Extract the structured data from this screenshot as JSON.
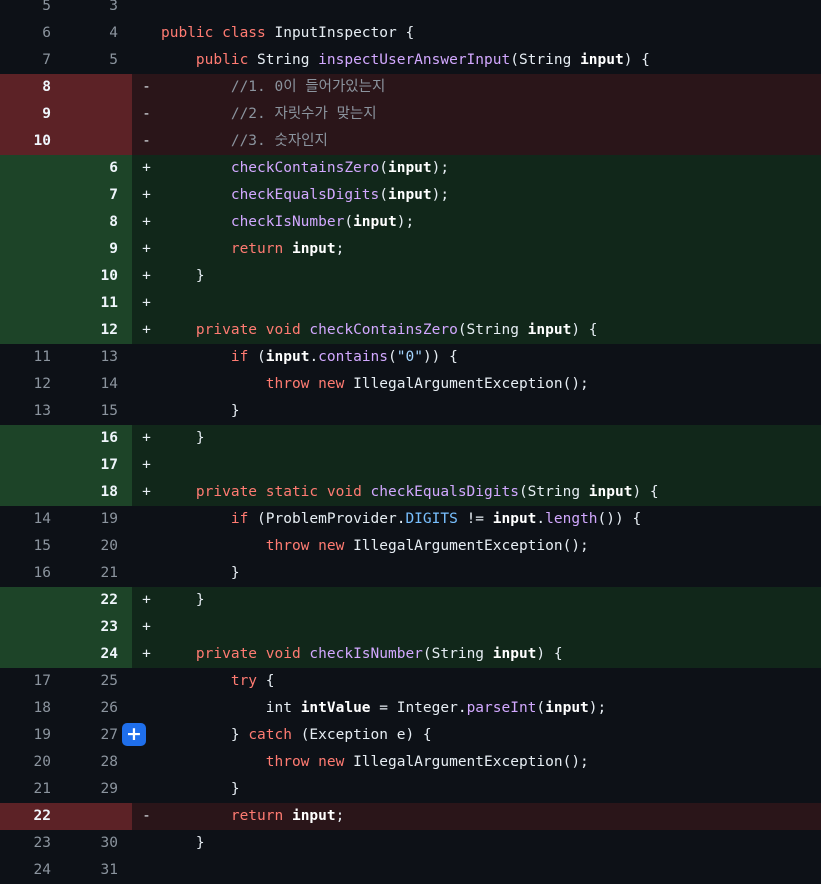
{
  "colors": {
    "background": "#0d1117",
    "deleted_row": "#2a1519",
    "deleted_gutter": "#5c2226",
    "added_row": "#11271a",
    "added_gutter": "#1d4428",
    "keyword": "#ff7b72",
    "function": "#d2a8ff",
    "string": "#a5d6ff",
    "constant": "#79c0ff",
    "comment": "#8b949e",
    "expand_button": "#1f6feb"
  },
  "expand_button": {
    "icon": "plus-icon",
    "glyph": "+"
  },
  "lines": [
    {
      "type": "ctx",
      "old": "5",
      "new": "3",
      "sign": "",
      "tokens": []
    },
    {
      "type": "ctx",
      "old": "6",
      "new": "4",
      "sign": "",
      "tokens": [
        {
          "t": "kw",
          "v": "public class"
        },
        {
          "t": "",
          "v": " InputInspector {"
        }
      ]
    },
    {
      "type": "ctx",
      "old": "7",
      "new": "5",
      "sign": "",
      "tokens": [
        {
          "t": "",
          "v": "    "
        },
        {
          "t": "kw",
          "v": "public"
        },
        {
          "t": "",
          "v": " String "
        },
        {
          "t": "fn",
          "v": "inspectUserAnswerInput"
        },
        {
          "t": "",
          "v": "(String "
        },
        {
          "t": "var",
          "v": "input"
        },
        {
          "t": "",
          "v": ") {"
        }
      ]
    },
    {
      "type": "del",
      "old": "8",
      "new": "",
      "sign": "-",
      "tokens": [
        {
          "t": "",
          "v": "        "
        },
        {
          "t": "cm",
          "v": "//1. 0이 들어가있는지"
        }
      ]
    },
    {
      "type": "del",
      "old": "9",
      "new": "",
      "sign": "-",
      "tokens": [
        {
          "t": "",
          "v": "        "
        },
        {
          "t": "cm",
          "v": "//2. 자릿수가 맞는지"
        }
      ]
    },
    {
      "type": "del",
      "old": "10",
      "new": "",
      "sign": "-",
      "tokens": [
        {
          "t": "",
          "v": "        "
        },
        {
          "t": "cm",
          "v": "//3. 숫자인지"
        }
      ]
    },
    {
      "type": "add",
      "old": "",
      "new": "6",
      "sign": "+",
      "tokens": [
        {
          "t": "",
          "v": "        "
        },
        {
          "t": "fn",
          "v": "checkContainsZero"
        },
        {
          "t": "",
          "v": "("
        },
        {
          "t": "var",
          "v": "input"
        },
        {
          "t": "",
          "v": ");"
        }
      ]
    },
    {
      "type": "add",
      "old": "",
      "new": "7",
      "sign": "+",
      "tokens": [
        {
          "t": "",
          "v": "        "
        },
        {
          "t": "fn",
          "v": "checkEqualsDigits"
        },
        {
          "t": "",
          "v": "("
        },
        {
          "t": "var",
          "v": "input"
        },
        {
          "t": "",
          "v": ");"
        }
      ]
    },
    {
      "type": "add",
      "old": "",
      "new": "8",
      "sign": "+",
      "tokens": [
        {
          "t": "",
          "v": "        "
        },
        {
          "t": "fn",
          "v": "checkIsNumber"
        },
        {
          "t": "",
          "v": "("
        },
        {
          "t": "var",
          "v": "input"
        },
        {
          "t": "",
          "v": ");"
        }
      ]
    },
    {
      "type": "add",
      "old": "",
      "new": "9",
      "sign": "+",
      "tokens": [
        {
          "t": "",
          "v": "        "
        },
        {
          "t": "kw",
          "v": "return"
        },
        {
          "t": "",
          "v": " "
        },
        {
          "t": "var",
          "v": "input"
        },
        {
          "t": "",
          "v": ";"
        }
      ]
    },
    {
      "type": "add",
      "old": "",
      "new": "10",
      "sign": "+",
      "tokens": [
        {
          "t": "",
          "v": "    }"
        }
      ]
    },
    {
      "type": "add",
      "old": "",
      "new": "11",
      "sign": "+",
      "tokens": []
    },
    {
      "type": "add",
      "old": "",
      "new": "12",
      "sign": "+",
      "tokens": [
        {
          "t": "",
          "v": "    "
        },
        {
          "t": "kw",
          "v": "private"
        },
        {
          "t": "",
          "v": " "
        },
        {
          "t": "kw",
          "v": "void"
        },
        {
          "t": "",
          "v": " "
        },
        {
          "t": "fn",
          "v": "checkContainsZero"
        },
        {
          "t": "",
          "v": "(String "
        },
        {
          "t": "var",
          "v": "input"
        },
        {
          "t": "",
          "v": ") {"
        }
      ]
    },
    {
      "type": "ctx",
      "old": "11",
      "new": "13",
      "sign": "",
      "tokens": [
        {
          "t": "",
          "v": "        "
        },
        {
          "t": "kw",
          "v": "if"
        },
        {
          "t": "",
          "v": " ("
        },
        {
          "t": "var",
          "v": "input"
        },
        {
          "t": "",
          "v": "."
        },
        {
          "t": "fn",
          "v": "contains"
        },
        {
          "t": "",
          "v": "("
        },
        {
          "t": "str",
          "v": "\"0\""
        },
        {
          "t": "",
          "v": ")) {"
        }
      ]
    },
    {
      "type": "ctx",
      "old": "12",
      "new": "14",
      "sign": "",
      "tokens": [
        {
          "t": "",
          "v": "            "
        },
        {
          "t": "kw",
          "v": "throw new"
        },
        {
          "t": "",
          "v": " IllegalArgumentException();"
        }
      ]
    },
    {
      "type": "ctx",
      "old": "13",
      "new": "15",
      "sign": "",
      "tokens": [
        {
          "t": "",
          "v": "        }"
        }
      ]
    },
    {
      "type": "add",
      "old": "",
      "new": "16",
      "sign": "+",
      "tokens": [
        {
          "t": "",
          "v": "    }"
        }
      ]
    },
    {
      "type": "add",
      "old": "",
      "new": "17",
      "sign": "+",
      "tokens": []
    },
    {
      "type": "add",
      "old": "",
      "new": "18",
      "sign": "+",
      "tokens": [
        {
          "t": "",
          "v": "    "
        },
        {
          "t": "kw",
          "v": "private static"
        },
        {
          "t": "",
          "v": " "
        },
        {
          "t": "kw",
          "v": "void"
        },
        {
          "t": "",
          "v": " "
        },
        {
          "t": "fn",
          "v": "checkEqualsDigits"
        },
        {
          "t": "",
          "v": "(String "
        },
        {
          "t": "var",
          "v": "input"
        },
        {
          "t": "",
          "v": ") {"
        }
      ]
    },
    {
      "type": "ctx",
      "old": "14",
      "new": "19",
      "sign": "",
      "tokens": [
        {
          "t": "",
          "v": "        "
        },
        {
          "t": "kw",
          "v": "if"
        },
        {
          "t": "",
          "v": " (ProblemProvider."
        },
        {
          "t": "const",
          "v": "DIGITS"
        },
        {
          "t": "",
          "v": " != "
        },
        {
          "t": "var",
          "v": "input"
        },
        {
          "t": "",
          "v": "."
        },
        {
          "t": "fn",
          "v": "length"
        },
        {
          "t": "",
          "v": "()) {"
        }
      ]
    },
    {
      "type": "ctx",
      "old": "15",
      "new": "20",
      "sign": "",
      "tokens": [
        {
          "t": "",
          "v": "            "
        },
        {
          "t": "kw",
          "v": "throw new"
        },
        {
          "t": "",
          "v": " IllegalArgumentException();"
        }
      ]
    },
    {
      "type": "ctx",
      "old": "16",
      "new": "21",
      "sign": "",
      "tokens": [
        {
          "t": "",
          "v": "        }"
        }
      ]
    },
    {
      "type": "add",
      "old": "",
      "new": "22",
      "sign": "+",
      "tokens": [
        {
          "t": "",
          "v": "    }"
        }
      ]
    },
    {
      "type": "add",
      "old": "",
      "new": "23",
      "sign": "+",
      "tokens": []
    },
    {
      "type": "add",
      "old": "",
      "new": "24",
      "sign": "+",
      "tokens": [
        {
          "t": "",
          "v": "    "
        },
        {
          "t": "kw",
          "v": "private"
        },
        {
          "t": "",
          "v": " "
        },
        {
          "t": "kw",
          "v": "void"
        },
        {
          "t": "",
          "v": " "
        },
        {
          "t": "fn",
          "v": "checkIsNumber"
        },
        {
          "t": "",
          "v": "(String "
        },
        {
          "t": "var",
          "v": "input"
        },
        {
          "t": "",
          "v": ") {"
        }
      ]
    },
    {
      "type": "ctx",
      "old": "17",
      "new": "25",
      "sign": "",
      "tokens": [
        {
          "t": "",
          "v": "        "
        },
        {
          "t": "kw",
          "v": "try"
        },
        {
          "t": "",
          "v": " {"
        }
      ]
    },
    {
      "type": "ctx",
      "old": "18",
      "new": "26",
      "sign": "",
      "tokens": [
        {
          "t": "",
          "v": "            int "
        },
        {
          "t": "var",
          "v": "intValue"
        },
        {
          "t": "",
          "v": " = Integer."
        },
        {
          "t": "fn",
          "v": "parseInt"
        },
        {
          "t": "",
          "v": "("
        },
        {
          "t": "var",
          "v": "input"
        },
        {
          "t": "",
          "v": ");"
        }
      ]
    },
    {
      "type": "ctx",
      "old": "19",
      "new": "27",
      "sign": "",
      "expand": true,
      "tokens": [
        {
          "t": "",
          "v": "        } "
        },
        {
          "t": "kw",
          "v": "catch"
        },
        {
          "t": "",
          "v": " (Exception e) {"
        }
      ]
    },
    {
      "type": "ctx",
      "old": "20",
      "new": "28",
      "sign": "",
      "tokens": [
        {
          "t": "",
          "v": "            "
        },
        {
          "t": "kw",
          "v": "throw new"
        },
        {
          "t": "",
          "v": " IllegalArgumentException();"
        }
      ]
    },
    {
      "type": "ctx",
      "old": "21",
      "new": "29",
      "sign": "",
      "tokens": [
        {
          "t": "",
          "v": "        }"
        }
      ]
    },
    {
      "type": "del",
      "old": "22",
      "new": "",
      "sign": "-",
      "tokens": [
        {
          "t": "",
          "v": "        "
        },
        {
          "t": "kw",
          "v": "return"
        },
        {
          "t": "",
          "v": " "
        },
        {
          "t": "var",
          "v": "input"
        },
        {
          "t": "",
          "v": ";"
        }
      ]
    },
    {
      "type": "ctx",
      "old": "23",
      "new": "30",
      "sign": "",
      "tokens": [
        {
          "t": "",
          "v": "    }"
        }
      ]
    },
    {
      "type": "ctx",
      "old": "24",
      "new": "31",
      "sign": "",
      "tokens": []
    }
  ]
}
